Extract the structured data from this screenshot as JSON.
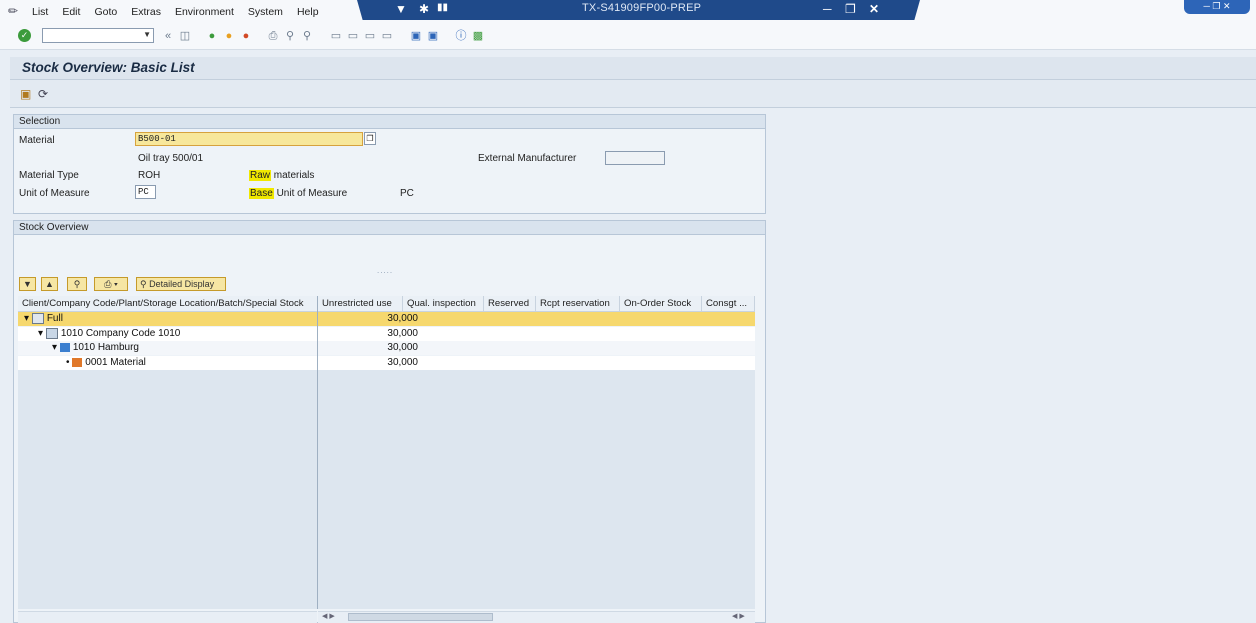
{
  "window": {
    "title": "TX-S41909FP00-PREP"
  },
  "menu": [
    "List",
    "Edit",
    "Goto",
    "Extras",
    "Environment",
    "System",
    "Help"
  ],
  "page": {
    "title": "Stock Overview: Basic List"
  },
  "selection": {
    "section_title": "Selection",
    "material_label": "Material",
    "material_value": "B500-01",
    "material_desc": "Oil tray 500/01",
    "ext_manufacturer_label": "External Manufacturer",
    "material_type_label": "Material Type",
    "material_type_value": "ROH",
    "material_type_desc_hl": "Raw",
    "material_type_desc_rest": " materials",
    "uom_label": "Unit of Measure",
    "uom_value": "PC",
    "base_uom_label_hl": "Base",
    "base_uom_label_rest": " Unit of Measure",
    "base_uom_value": "PC"
  },
  "stock_overview": {
    "section_title": "Stock Overview",
    "detailed_display_label": "Detailed Display",
    "columns": [
      "Client/Company Code/Plant/Storage Location/Batch/Special Stock",
      "Unrestricted use",
      "Qual. inspection",
      "Reserved",
      "Rcpt reservation",
      "On-Order Stock",
      "Consgt ..."
    ],
    "rows": [
      {
        "label": "Full",
        "value": "30,000"
      },
      {
        "label": "1010 Company Code 1010",
        "value": "30,000"
      },
      {
        "label": "1010 Hamburg",
        "value": "30,000"
      },
      {
        "label": "0001 Material",
        "value": "30,000"
      }
    ]
  },
  "colors": {
    "selected_row": "#f6d86e",
    "title_bar": "#1f4a8a",
    "material_field": "#f7e79b"
  }
}
